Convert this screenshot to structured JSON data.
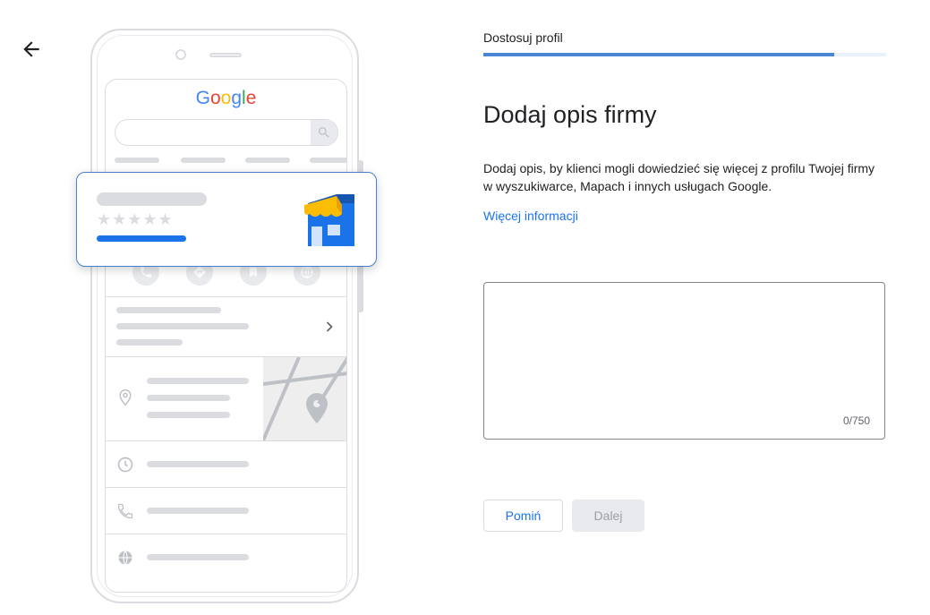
{
  "nav": {
    "back_icon": "arrow-back-icon"
  },
  "illustration": {
    "logo_letters": [
      {
        "char": "G",
        "color": "#4285F4"
      },
      {
        "char": "o",
        "color": "#EA4335"
      },
      {
        "char": "o",
        "color": "#FBBC05"
      },
      {
        "char": "g",
        "color": "#4285F4"
      },
      {
        "char": "l",
        "color": "#34A853"
      },
      {
        "char": "e",
        "color": "#EA4335"
      }
    ],
    "stars": "★★★★★",
    "icons": [
      "search-icon",
      "phone-icon",
      "directions-icon",
      "bookmark-icon",
      "globe-icon",
      "chevron-right-icon",
      "location-pin-icon",
      "clock-icon",
      "storefront-icon"
    ]
  },
  "progress": {
    "step_label": "Dostosuj profil",
    "fraction": 0.87
  },
  "content": {
    "title": "Dodaj opis firmy",
    "description": "Dodaj opis, by klienci mogli dowiedzieć się więcej z profilu Twojej firmy w wyszukiwarce, Mapach i innych usługach Google.",
    "more_link": "Więcej informacji"
  },
  "description_field": {
    "value": "",
    "counter": "0/750"
  },
  "actions": {
    "skip_label": "Pomiń",
    "next_label": "Dalej"
  },
  "colors": {
    "accent": "#1a73e8",
    "progress": "#4a86d4",
    "store_blue": "#1a73e8",
    "store_awning": "#fbbc04"
  }
}
